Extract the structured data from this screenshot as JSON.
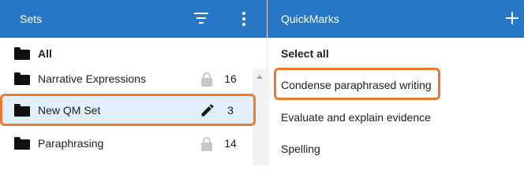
{
  "sets_panel": {
    "title": "Sets",
    "items": [
      {
        "label": "All",
        "count": "",
        "icon": "folder-icon",
        "status_icon": ""
      },
      {
        "label": "Narrative Expressions",
        "count": "16",
        "icon": "folder-icon",
        "status_icon": "lock-icon"
      },
      {
        "label": "New QM Set",
        "count": "3",
        "icon": "folder-icon",
        "status_icon": "pencil-icon"
      },
      {
        "label": "Paraphrasing",
        "count": "14",
        "icon": "folder-icon",
        "status_icon": "lock-icon"
      }
    ]
  },
  "quickmarks_panel": {
    "title": "QuickMarks",
    "select_all_label": "Select all",
    "items": [
      {
        "label": "Condense paraphrased writing"
      },
      {
        "label": "Evaluate and explain evidence"
      },
      {
        "label": "Spelling"
      }
    ]
  },
  "colors": {
    "header_bg": "#2777c7",
    "selected_row_bg": "#e1eefb",
    "highlight_outline": "#ea7a2e"
  }
}
